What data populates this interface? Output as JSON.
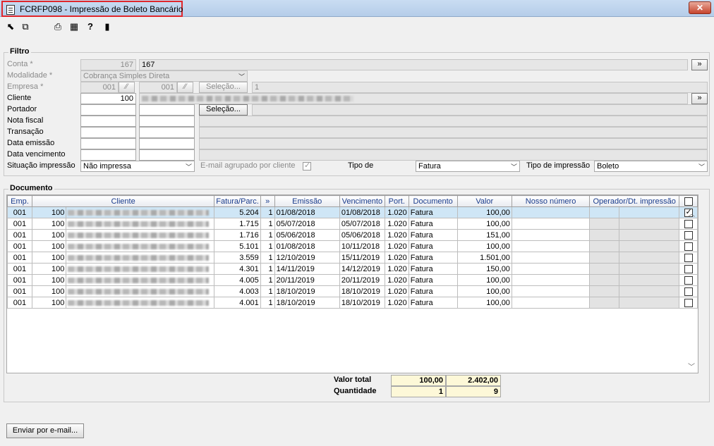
{
  "window": {
    "title": "FCRFP098 - Impressão de Boleto Bancário",
    "close_label": "✕"
  },
  "filtro": {
    "group_label": "Filtro",
    "conta_label": "Conta *",
    "conta_code": "167",
    "conta_desc": "167",
    "modalidade_label": "Modalidade *",
    "modalidade_value": "Cobrança Simples Direta",
    "empresa_label": "Empresa *",
    "empresa_from": "001",
    "empresa_to": "001",
    "selecao_label": "Seleção...",
    "empresa_count": "1",
    "cliente_label": "Cliente",
    "cliente_code": "100",
    "portador_label": "Portador",
    "nota_fiscal_label": "Nota fiscal",
    "transacao_label": "Transação",
    "data_emissao_label": "Data emissão",
    "data_vencimento_label": "Data vencimento",
    "situacao_label": "Situação impressão",
    "situacao_value": "Não impressa",
    "email_agrupado_label": "E-mail agrupado por cliente",
    "tipo_de_label": "Tipo de",
    "tipo_de_value": "Fatura",
    "tipo_impressao_label": "Tipo de impressão",
    "tipo_impressao_value": "Boleto",
    "more_label": "»"
  },
  "documento": {
    "group_label": "Documento",
    "columns": [
      "Emp.",
      "Cliente",
      "Fatura/Parc.",
      "»",
      "Emissão",
      "Vencimento",
      "Port.",
      "Documento",
      "Valor",
      "Nosso número",
      "Operador/Dt. impressão",
      ""
    ],
    "rows": [
      {
        "emp": "001",
        "cliente": "100",
        "fatura": "5.204",
        "parc": "1",
        "emissao": "01/08/2018",
        "vencimento": "01/08/2018",
        "port": "1.020",
        "documento": "Fatura",
        "valor": "100,00",
        "checked": true
      },
      {
        "emp": "001",
        "cliente": "100",
        "fatura": "1.715",
        "parc": "1",
        "emissao": "05/07/2018",
        "vencimento": "05/07/2018",
        "port": "1.020",
        "documento": "Fatura",
        "valor": "100,00",
        "checked": false
      },
      {
        "emp": "001",
        "cliente": "100",
        "fatura": "1.716",
        "parc": "1",
        "emissao": "05/06/2018",
        "vencimento": "05/06/2018",
        "port": "1.020",
        "documento": "Fatura",
        "valor": "151,00",
        "checked": false
      },
      {
        "emp": "001",
        "cliente": "100",
        "fatura": "5.101",
        "parc": "1",
        "emissao": "01/08/2018",
        "vencimento": "10/11/2018",
        "port": "1.020",
        "documento": "Fatura",
        "valor": "100,00",
        "checked": false
      },
      {
        "emp": "001",
        "cliente": "100",
        "fatura": "3.559",
        "parc": "1",
        "emissao": "12/10/2019",
        "vencimento": "15/11/2019",
        "port": "1.020",
        "documento": "Fatura",
        "valor": "1.501,00",
        "checked": false
      },
      {
        "emp": "001",
        "cliente": "100",
        "fatura": "4.301",
        "parc": "1",
        "emissao": "14/11/2019",
        "vencimento": "14/12/2019",
        "port": "1.020",
        "documento": "Fatura",
        "valor": "150,00",
        "checked": false
      },
      {
        "emp": "001",
        "cliente": "100",
        "fatura": "4.005",
        "parc": "1",
        "emissao": "20/11/2019",
        "vencimento": "20/11/2019",
        "port": "1.020",
        "documento": "Fatura",
        "valor": "100,00",
        "checked": false
      },
      {
        "emp": "001",
        "cliente": "100",
        "fatura": "4.003",
        "parc": "1",
        "emissao": "18/10/2019",
        "vencimento": "18/10/2019",
        "port": "1.020",
        "documento": "Fatura",
        "valor": "100,00",
        "checked": false
      },
      {
        "emp": "001",
        "cliente": "100",
        "fatura": "4.001",
        "parc": "1",
        "emissao": "18/10/2019",
        "vencimento": "18/10/2019",
        "port": "1.020",
        "documento": "Fatura",
        "valor": "100,00",
        "checked": false
      }
    ],
    "totals": {
      "valor_total_label": "Valor total",
      "valor_total_selected": "100,00",
      "valor_total_all": "2.402,00",
      "quantidade_label": "Quantidade",
      "quantidade_selected": "1",
      "quantidade_all": "9"
    }
  },
  "footer": {
    "email_button": "Enviar por e-mail..."
  },
  "icons": [
    "arrow-out-icon",
    "copy-icon",
    "print-icon",
    "grid-icon",
    "help-icon",
    "exit-door-icon"
  ],
  "colors": {
    "selected_row": "#cfe6f6",
    "totals_bg": "#fdf8d8",
    "title_highlight": "#e0262b",
    "header_text": "#1a3c8c"
  }
}
